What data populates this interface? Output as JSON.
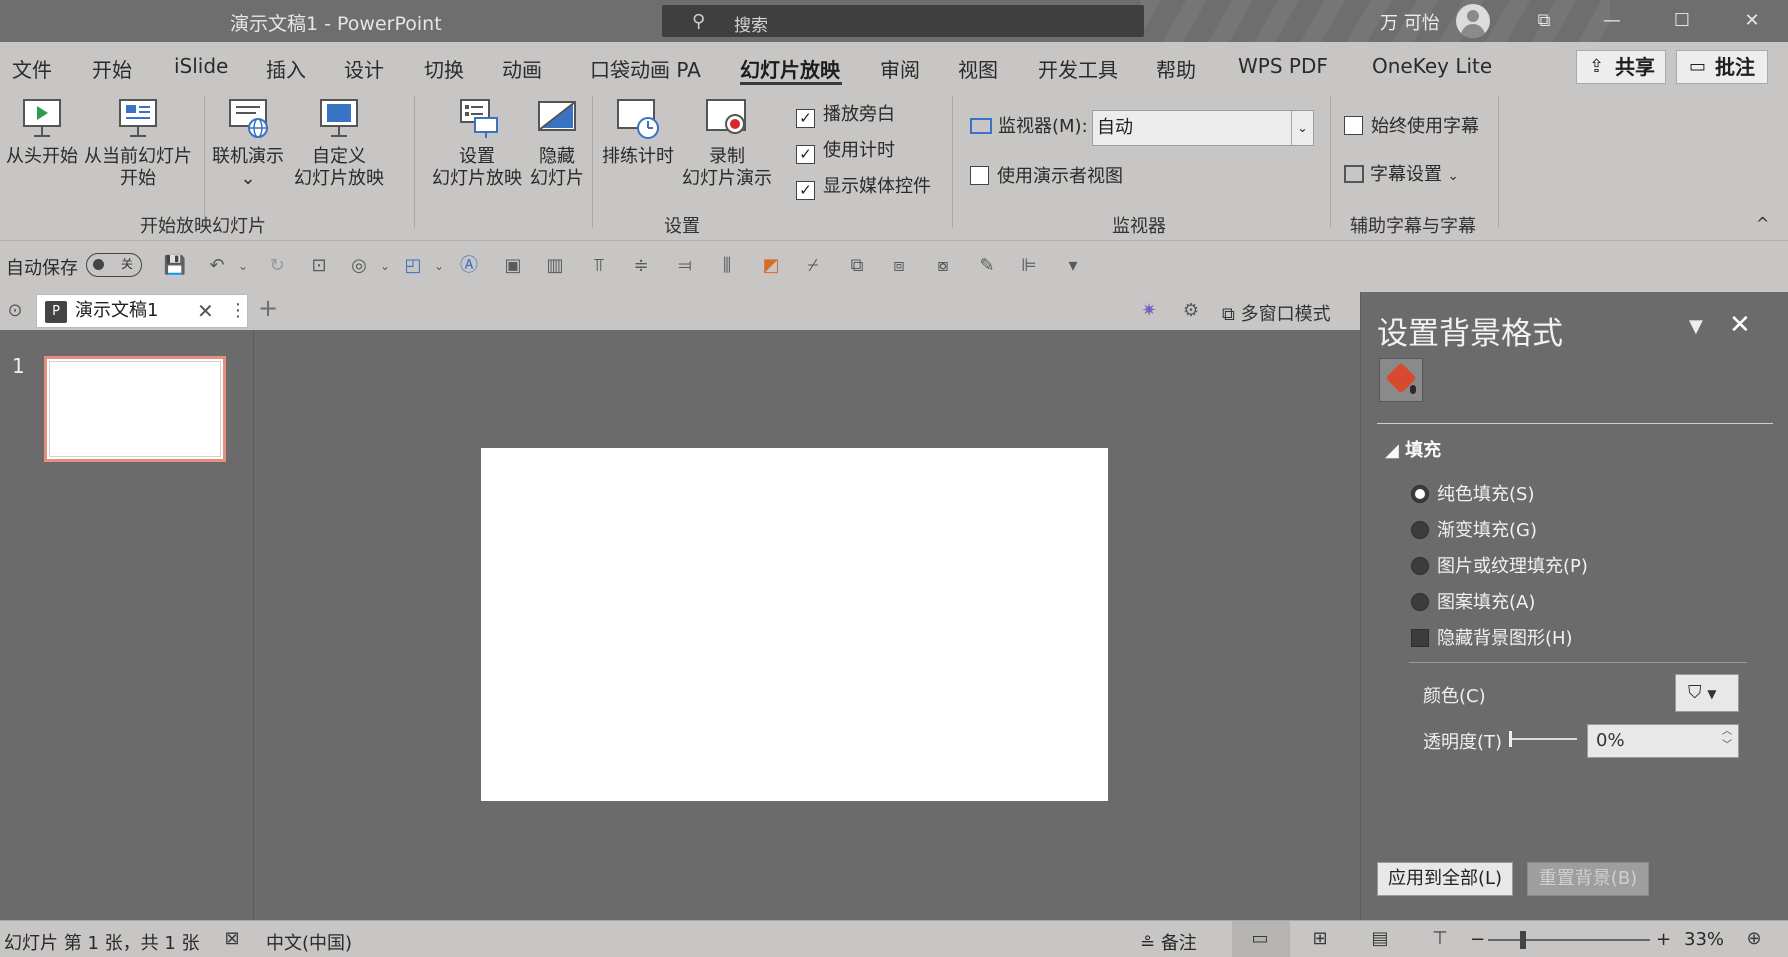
{
  "titlebar": {
    "doc_title": "演示文稿1  -  PowerPoint",
    "search_placeholder": "搜索",
    "user_name": "万 可怡",
    "min_label": "—",
    "max_label": "☐",
    "close_label": "✕",
    "restore_label": "⧉"
  },
  "menu": {
    "tabs": [
      "文件",
      "开始",
      "iSlide",
      "插入",
      "设计",
      "切换",
      "动画",
      "口袋动画 PA",
      "幻灯片放映",
      "审阅",
      "视图",
      "开发工具",
      "帮助",
      "WPS PDF",
      "OneKey Lite"
    ],
    "active_tab": "幻灯片放映",
    "share_label": "共享",
    "comment_label": "批注"
  },
  "ribbon": {
    "start_group": {
      "label": "开始放映幻灯片",
      "from_start": "从头开始",
      "from_current_1": "从当前幻灯片",
      "from_current_2": "开始",
      "online_1": "联机演示",
      "custom_1": "自定义",
      "custom_2": "幻灯片放映"
    },
    "setup_group": {
      "label": "设置",
      "setup_1": "设置",
      "setup_2": "幻灯片放映",
      "hide_1": "隐藏",
      "hide_2": "幻灯片",
      "rehearse": "排练计时",
      "record_1": "录制",
      "record_2": "幻灯片演示",
      "play_narration": "播放旁白",
      "use_timings": "使用计时",
      "show_media": "显示媒体控件"
    },
    "monitor_group": {
      "label": "监视器",
      "monitor_label": "监视器(M):",
      "monitor_value": "自动",
      "presenter_view": "使用演示者视图"
    },
    "captions_group": {
      "label": "辅助字幕与字幕",
      "always_subtitles": "始终使用字幕",
      "subtitle_settings": "字幕设置"
    }
  },
  "qat": {
    "autosave_label": "自动保存",
    "autosave_state": "关"
  },
  "tabstrip": {
    "doc_tab": "演示文稿1",
    "multi_window": "多窗口模式"
  },
  "thumbs": {
    "slide_number": "1"
  },
  "pane": {
    "title": "设置背景格式",
    "fill_heading": "填充",
    "options": [
      "纯色填充(S)",
      "渐变填充(G)",
      "图片或纹理填充(P)",
      "图案填充(A)"
    ],
    "selected_option": "纯色填充(S)",
    "hide_bg_graphics": "隐藏背景图形(H)",
    "color_label": "颜色(C)",
    "transparency_label": "透明度(T)",
    "transparency_value": "0%",
    "apply_all": "应用到全部(L)",
    "reset_bg": "重置背景(B)"
  },
  "statusbar": {
    "slide_info": "幻灯片 第 1 张，共 1 张",
    "language": "中文(中国)",
    "notes_label": "备注",
    "zoom_value": "33%",
    "zoom_minus": "−",
    "zoom_plus": "+"
  },
  "colors": {
    "accent_thumb_border": "#e68f7e",
    "fill_icon": "#d84a2f",
    "save_icon": "#a4286a"
  }
}
